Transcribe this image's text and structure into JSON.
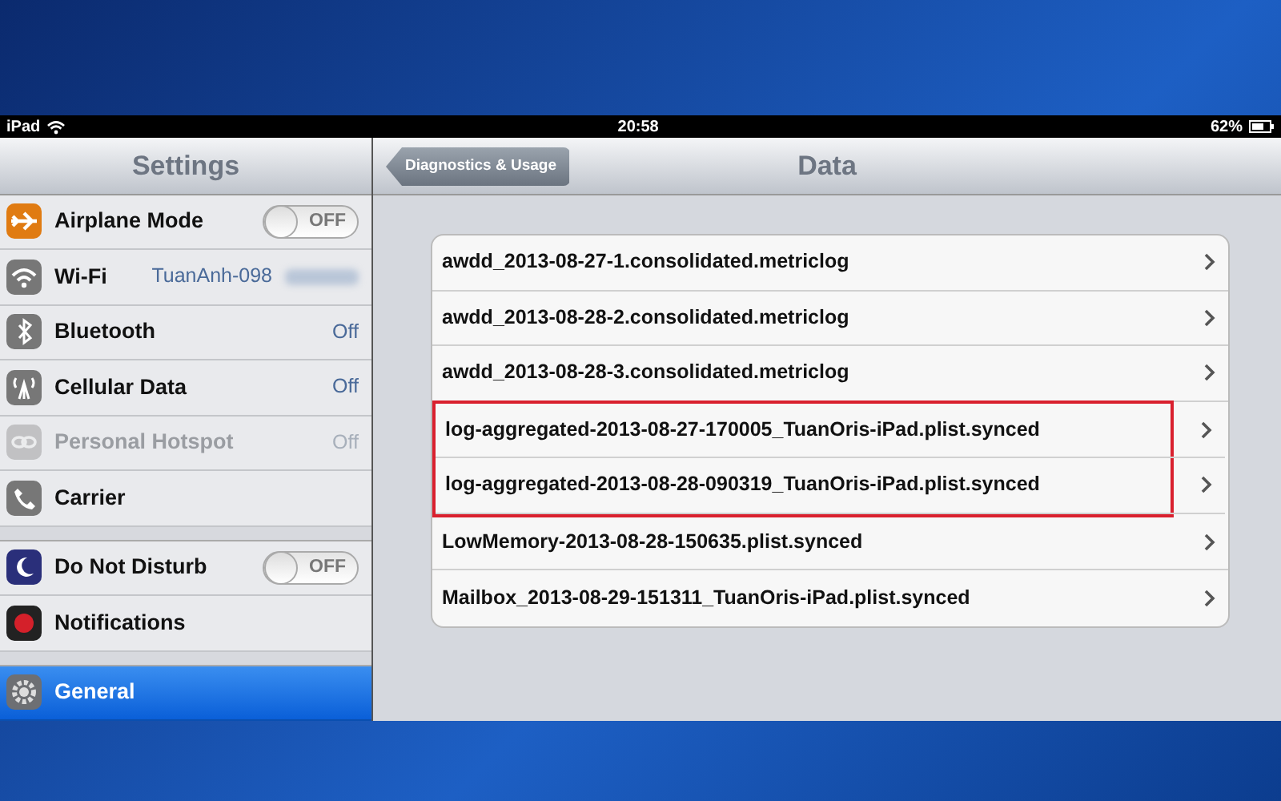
{
  "status_bar": {
    "device": "iPad",
    "time": "20:58",
    "battery": "62%"
  },
  "sidebar": {
    "title": "Settings",
    "groups": [
      [
        {
          "label": "Airplane Mode",
          "kind": "toggle",
          "on": false,
          "toggle_label": "OFF",
          "disabled": false,
          "selected": false
        },
        {
          "label": "Wi-Fi",
          "kind": "value",
          "value": "TuanAnh-098",
          "value_blurred": true,
          "disabled": false,
          "selected": false
        },
        {
          "label": "Bluetooth",
          "kind": "value",
          "value": "Off",
          "disabled": false,
          "selected": false
        },
        {
          "label": "Cellular Data",
          "kind": "value",
          "value": "Off",
          "disabled": false,
          "selected": false
        },
        {
          "label": "Personal Hotspot",
          "kind": "value",
          "value": "Off",
          "disabled": true,
          "selected": false
        },
        {
          "label": "Carrier",
          "kind": "plain",
          "disabled": false,
          "selected": false
        }
      ],
      [
        {
          "label": "Do Not Disturb",
          "kind": "toggle",
          "on": false,
          "toggle_label": "OFF",
          "disabled": false,
          "selected": false
        },
        {
          "label": "Notifications",
          "kind": "plain",
          "disabled": false,
          "selected": false
        }
      ],
      [
        {
          "label": "General",
          "kind": "plain",
          "disabled": false,
          "selected": true
        }
      ]
    ]
  },
  "detail": {
    "back_button": "Diagnostics & Usage",
    "title": "Data",
    "rows": [
      {
        "label": "awdd_2013-08-27-1.consolidated.metriclog",
        "highlighted": false
      },
      {
        "label": "awdd_2013-08-28-2.consolidated.metriclog",
        "highlighted": false
      },
      {
        "label": "awdd_2013-08-28-3.consolidated.metriclog",
        "highlighted": false
      },
      {
        "label": "log-aggregated-2013-08-27-170005_TuanOris-iPad.plist.synced",
        "highlighted": true
      },
      {
        "label": "log-aggregated-2013-08-28-090319_TuanOris-iPad.plist.synced",
        "highlighted": true
      },
      {
        "label": "LowMemory-2013-08-28-150635.plist.synced",
        "highlighted": false
      },
      {
        "label": "Mailbox_2013-08-29-151311_TuanOris-iPad.plist.synced",
        "highlighted": false
      }
    ]
  }
}
